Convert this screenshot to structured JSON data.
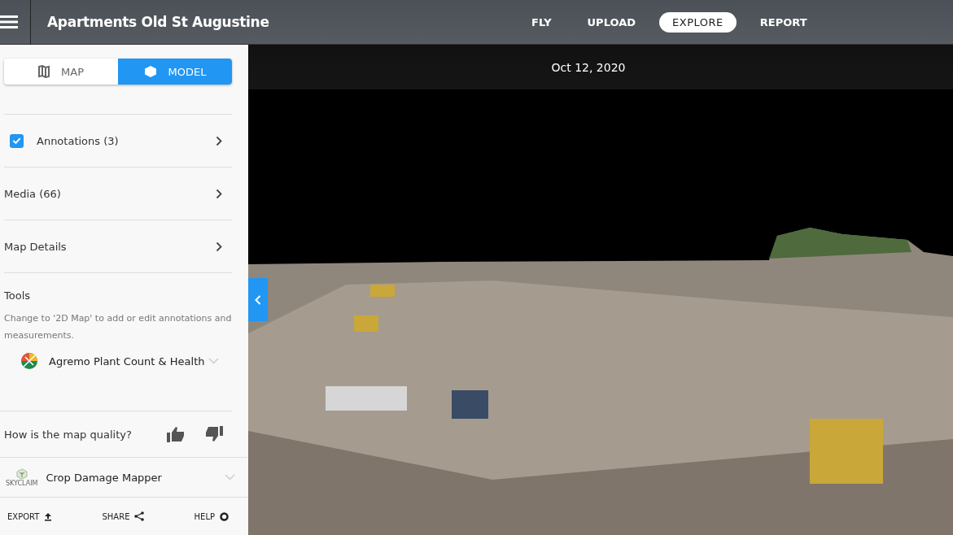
{
  "header": {
    "title": "Apartments Old St Augustine",
    "nav": [
      {
        "label": "FLY",
        "selected": false
      },
      {
        "label": "UPLOAD",
        "selected": false
      },
      {
        "label": "EXPLORE",
        "selected": true
      },
      {
        "label": "REPORT",
        "selected": false
      }
    ]
  },
  "view_toggle": [
    {
      "label": "MAP",
      "kind": "map",
      "selected": false
    },
    {
      "label": "MODEL",
      "kind": "model",
      "selected": true
    }
  ],
  "sections": [
    {
      "label": "Annotations (3)",
      "kind": "checkbox",
      "checked": true
    },
    {
      "label": "Media (66)",
      "kind": "link"
    },
    {
      "label": "Map Details",
      "kind": "link"
    }
  ],
  "tools": {
    "title": "Tools",
    "hint": "Change to '2D Map' to add or edit annotations and measurements.",
    "items": [
      {
        "label": "Agremo Plant Count & Health"
      }
    ]
  },
  "feedback": {
    "question": "How is the map quality?"
  },
  "plugins": [
    {
      "label": "Crop Damage Mapper",
      "logo_text": "SKYCLAIM"
    }
  ],
  "footer": [
    {
      "label": "EXPORT",
      "kind": "export"
    },
    {
      "label": "SHARE",
      "kind": "share"
    },
    {
      "label": "HELP",
      "kind": "help"
    }
  ],
  "viewer": {
    "date": "Oct 12, 2020"
  }
}
